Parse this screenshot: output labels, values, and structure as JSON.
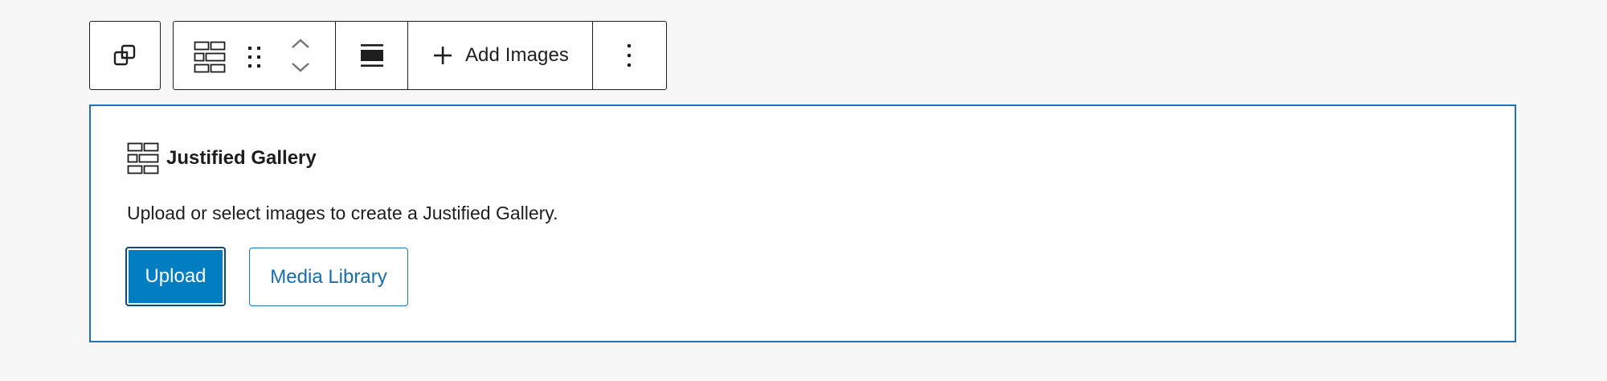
{
  "toolbar": {
    "transform_icon": "duplicate-squares-icon",
    "block_icon": "justified-gallery-icon",
    "drag_icon": "drag-handle-icon",
    "move_up_icon": "chevron-up-icon",
    "move_down_icon": "chevron-down-icon",
    "align_icon": "align-wide-icon",
    "add_icon": "plus-icon",
    "add_images_label": "Add Images",
    "more_icon": "more-vertical-icon"
  },
  "placeholder": {
    "icon": "justified-gallery-icon",
    "title": "Justified Gallery",
    "description": "Upload or select images to create a Justified Gallery.",
    "upload_label": "Upload",
    "media_library_label": "Media Library"
  },
  "colors": {
    "accent": "#007cba",
    "panel_border": "#1f72b8",
    "text": "#1e1e1e",
    "background": "#f7f7f7"
  }
}
